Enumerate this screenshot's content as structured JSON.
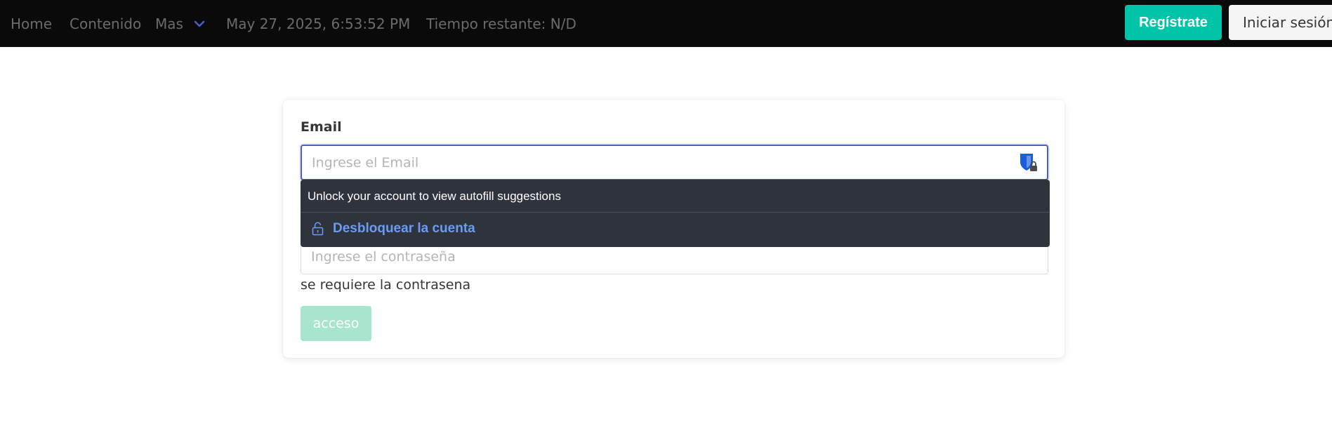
{
  "navbar": {
    "home_label": "Home",
    "contenido_label": "Contenido",
    "mas_label": "Mas",
    "datetime": "May 27, 2025, 6:53:52 PM",
    "time_remaining": "Tiempo restante: N/D",
    "register_label": "Regístrate",
    "login_label": "Iniciar sesión"
  },
  "form": {
    "email_label": "Email",
    "email_placeholder": "Ingrese el Email",
    "password_placeholder": "Ingrese el contraseña",
    "password_help": "se requiere la contrasena",
    "submit_label": "acceso"
  },
  "autofill": {
    "message": "Unlock your account to view autofill suggestions",
    "unlock_label": "Desbloquear la cuenta"
  },
  "colors": {
    "navbar_bg": "#0a0a0a",
    "primary": "#00c4a7",
    "focus": "#485fc7",
    "link_blue": "#6a9cf5"
  },
  "icons": {
    "mas_chevron": "chevron-down-icon",
    "password_manager": "shield-lock-icon",
    "unlock": "lock-open-icon"
  }
}
